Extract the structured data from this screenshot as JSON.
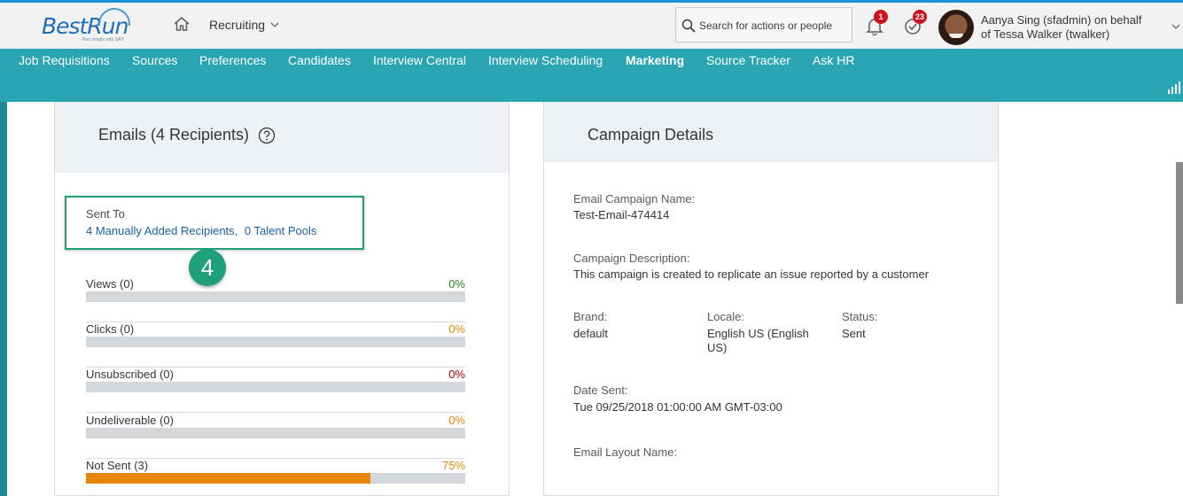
{
  "header": {
    "logo_text": "BestRun",
    "logo_tagline": "Run simple with SAP",
    "module": "Recruiting",
    "search_placeholder": "Search for actions or people",
    "notifications_count": "1",
    "todo_count": "23",
    "user_line1": "Aanya Sing (sfadmin) on behalf",
    "user_line2": "of Tessa Walker (twalker)"
  },
  "nav": {
    "items": [
      {
        "label": "Job Requisitions"
      },
      {
        "label": "Sources"
      },
      {
        "label": "Preferences"
      },
      {
        "label": "Candidates"
      },
      {
        "label": "Interview Central"
      },
      {
        "label": "Interview Scheduling"
      },
      {
        "label": "Marketing",
        "active": true
      },
      {
        "label": "Source Tracker"
      },
      {
        "label": "Ask HR"
      }
    ]
  },
  "emails": {
    "title": "Emails (4 Recipients)",
    "sent_to_label": "Sent To",
    "manual_link": "4 Manually Added Recipients,",
    "pools_link": "0 Talent Pools",
    "step_marker": "4",
    "metrics": [
      {
        "label": "Views (0)",
        "pct": "0%",
        "fill": 0,
        "pct_color": "#2b7d2b"
      },
      {
        "label": "Clicks (0)",
        "pct": "0%",
        "fill": 0,
        "pct_color": "#e5870a"
      },
      {
        "label": "Unsubscribed (0)",
        "pct": "0%",
        "fill": 0,
        "pct_color": "#bb0000"
      },
      {
        "label": "Undeliverable (0)",
        "pct": "0%",
        "fill": 0,
        "pct_color": "#e5870a"
      },
      {
        "label": "Not Sent (3)",
        "pct": "75%",
        "fill": 0.75,
        "pct_color": "#e5870a"
      }
    ]
  },
  "campaign": {
    "title": "Campaign Details",
    "name_label": "Email Campaign Name:",
    "name_value": "Test-Email-474414",
    "desc_label": "Campaign Description:",
    "desc_value": "This campaign is created to replicate an issue reported by a customer",
    "brand_label": "Brand:",
    "brand_value": "default",
    "locale_label": "Locale:",
    "locale_value": "English US (English US)",
    "status_label": "Status:",
    "status_value": "Sent",
    "date_label": "Date Sent:",
    "date_value": "Tue 09/25/2018 01:00:00 AM GMT-03:00",
    "layout_label": "Email Layout Name:"
  }
}
